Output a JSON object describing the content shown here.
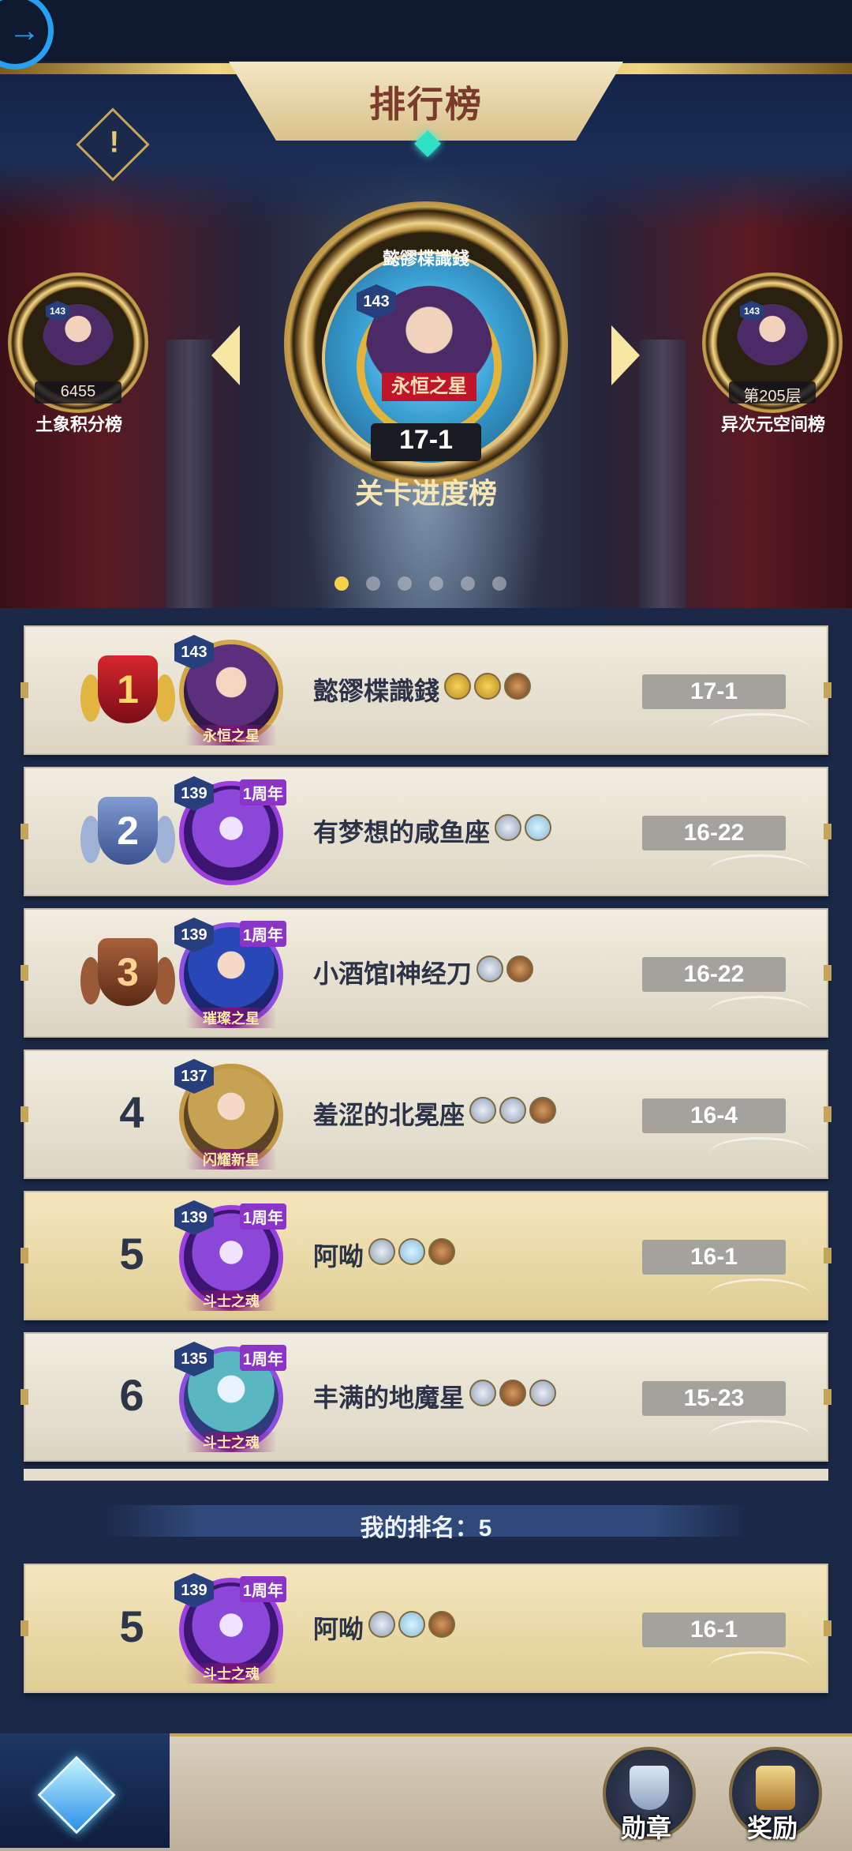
{
  "header": {
    "title": "排行榜",
    "back_icon": "→"
  },
  "carousel": {
    "main": {
      "name": "懿豂楪識錢",
      "level": "143",
      "title_badge": "永恒之星",
      "stage": "17-1",
      "label": "关卡进度榜"
    },
    "left": {
      "name": "懿豂楪識錢",
      "level": "143",
      "value": "6455",
      "label": "土象积分榜"
    },
    "right": {
      "name": "懿豂楪識錢",
      "level": "143",
      "value": "第205层",
      "label": "异次元空间榜"
    },
    "page_count": 6,
    "active_page": 0
  },
  "ranking": [
    {
      "rank": "1",
      "level": "143",
      "name": "懿豂楪識錢",
      "stage": "17-1",
      "tag": "永恒之星",
      "anniv": "",
      "emblems": [
        "g",
        "g",
        "b"
      ]
    },
    {
      "rank": "2",
      "level": "139",
      "name": "有梦想的咸鱼座",
      "stage": "16-22",
      "tag": "",
      "anniv": "1周年",
      "emblems": [
        "s",
        "t"
      ]
    },
    {
      "rank": "3",
      "level": "139",
      "name": "小酒馆I神经刀",
      "stage": "16-22",
      "tag": "璀璨之星",
      "anniv": "1周年",
      "emblems": [
        "s",
        "b"
      ]
    },
    {
      "rank": "4",
      "level": "137",
      "name": "羞涩的北冕座",
      "stage": "16-4",
      "tag": "闪耀新星",
      "anniv": "",
      "emblems": [
        "s",
        "s",
        "b"
      ]
    },
    {
      "rank": "5",
      "level": "139",
      "name": "阿呦",
      "stage": "16-1",
      "tag": "斗士之魂",
      "anniv": "1周年",
      "emblems": [
        "s",
        "t",
        "b"
      ]
    },
    {
      "rank": "6",
      "level": "135",
      "name": "丰满的地魔星",
      "stage": "15-23",
      "tag": "斗士之魂",
      "anniv": "1周年",
      "emblems": [
        "s",
        "b",
        "s"
      ]
    }
  ],
  "my_rank": {
    "label": "我的排名：5",
    "rank": "5",
    "level": "139",
    "name": "阿呦",
    "stage": "16-1",
    "tag": "斗士之魂",
    "anniv": "1周年"
  },
  "bottom_nav": {
    "medal_label": "勋章",
    "reward_label": "奖励"
  },
  "colors": {
    "accent_gold": "#f1d68a",
    "highlight_row": "#f4e7be",
    "stage_box": "#a3a29c"
  }
}
